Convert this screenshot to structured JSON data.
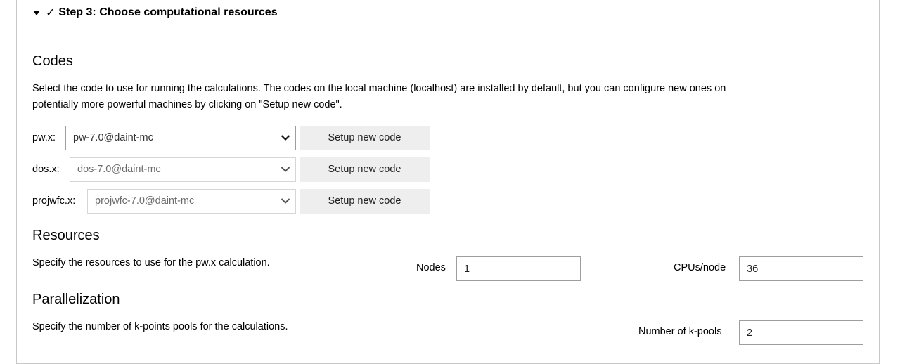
{
  "step": {
    "caret_icon": "caret-down-icon",
    "check_icon": "checkmark",
    "check_glyph": "✓",
    "title": "Step 3: Choose computational resources"
  },
  "codes": {
    "heading": "Codes",
    "description_line1": "Select the code to use for running the calculations. The codes on the local machine (localhost) are installed by default, but you can configure new ones on",
    "description_line2": "potentially more powerful machines by clicking on \"Setup new code\".",
    "rows": [
      {
        "label": "pw.x:",
        "selected": "pw-7.0@daint-mc",
        "setup_label": "Setup new code"
      },
      {
        "label": "dos.x:",
        "selected": "dos-7.0@daint-mc",
        "setup_label": "Setup new code"
      },
      {
        "label": "projwfc.x:",
        "selected": "projwfc-7.0@daint-mc",
        "setup_label": "Setup new code"
      }
    ]
  },
  "resources": {
    "heading": "Resources",
    "description": "Specify the resources to use for the pw.x calculation.",
    "nodes_label": "Nodes",
    "nodes_value": "1",
    "cpus_label": "CPUs/node",
    "cpus_value": "36"
  },
  "parallelization": {
    "heading": "Parallelization",
    "description": "Specify the number of k-points pools for the calculations.",
    "kpools_label": "Number of k-pools",
    "kpools_value": "2"
  },
  "colors": {
    "button_bg": "#eeeeee",
    "input_border": "#9e9e9e",
    "panel_border": "#c8c8c8"
  }
}
